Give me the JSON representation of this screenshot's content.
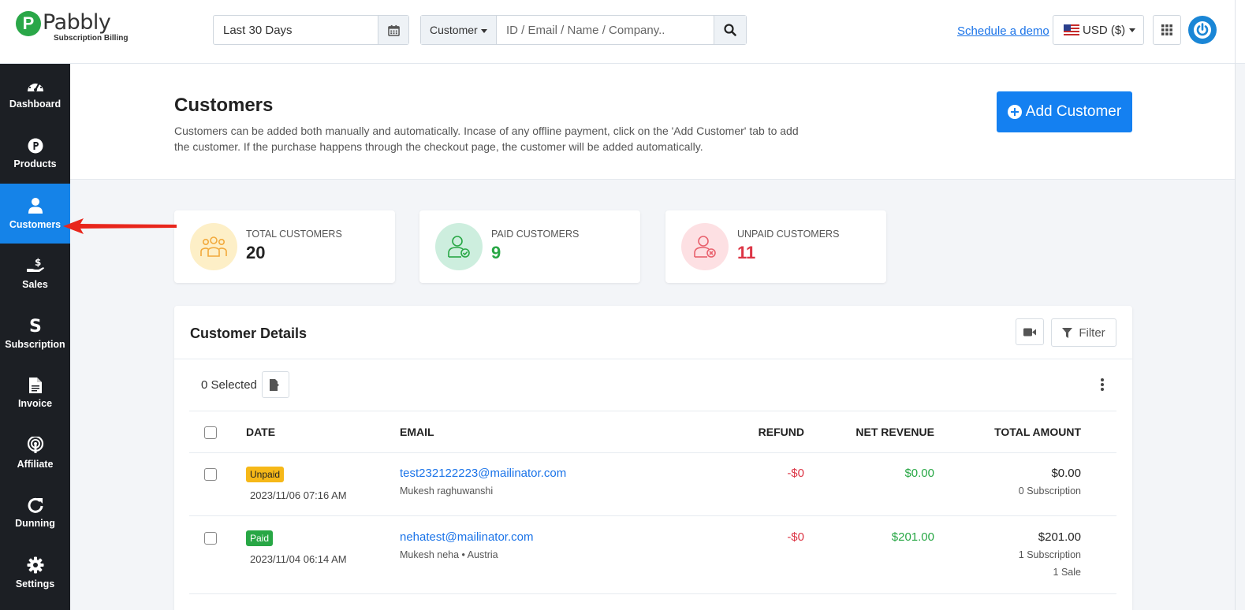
{
  "brand": {
    "logo_letter": "P",
    "name": "Pabbly",
    "subtitle": "Subscription Billing"
  },
  "topbar": {
    "date_range": "Last 30 Days",
    "search_type": "Customer",
    "search_placeholder": "ID / Email / Name / Company..",
    "schedule_link": "Schedule a demo",
    "currency": "USD ($)"
  },
  "sidebar": {
    "items": [
      {
        "label": "Dashboard",
        "icon": "speedometer-icon"
      },
      {
        "label": "Products",
        "icon": "products-p-icon"
      },
      {
        "label": "Customers",
        "icon": "user-icon",
        "active": true
      },
      {
        "label": "Sales",
        "icon": "hand-dollar-icon"
      },
      {
        "label": "Subscription",
        "icon": "subscription-s-icon"
      },
      {
        "label": "Invoice",
        "icon": "file-icon"
      },
      {
        "label": "Affiliate",
        "icon": "broadcast-icon"
      },
      {
        "label": "Dunning",
        "icon": "refresh-icon"
      },
      {
        "label": "Settings",
        "icon": "gear-icon"
      }
    ]
  },
  "header": {
    "title": "Customers",
    "description": "Customers can be added both manually and automatically. Incase of any offline payment, click on the 'Add Customer' tab to add the customer. If the purchase happens through the checkout page, the customer will be added automatically.",
    "add_button": "Add Customer"
  },
  "stats": {
    "total": {
      "label": "TOTAL CUSTOMERS",
      "value": "20",
      "color": "#222222",
      "bg": "#fdefc7",
      "icon_color": "#f2a93b"
    },
    "paid": {
      "label": "PAID CUSTOMERS",
      "value": "9",
      "color": "#28a745",
      "bg": "#cdeede",
      "icon_color": "#28a745"
    },
    "unpaid": {
      "label": "UNPAID CUSTOMERS",
      "value": "11",
      "color": "#dc3545",
      "bg": "#fde0e3",
      "icon_color": "#e8616d"
    }
  },
  "details": {
    "title": "Customer Details",
    "filter_label": "Filter",
    "selected_text": "0 Selected",
    "columns": {
      "date": "DATE",
      "email": "EMAIL",
      "refund": "REFUND",
      "net_revenue": "NET REVENUE",
      "total_amount": "TOTAL AMOUNT"
    },
    "rows": [
      {
        "status": "Unpaid",
        "date": "2023/11/06 07:16 AM",
        "email": "test232122223@mailinator.com",
        "name": "Mukesh raghuwanshi",
        "refund": "-$0",
        "net_revenue": "$0.00",
        "total": "$0.00",
        "sub1": "0 Subscription",
        "sub2": ""
      },
      {
        "status": "Paid",
        "date": "2023/11/04 06:14 AM",
        "email": "nehatest@mailinator.com",
        "name": "Mukesh neha • Austria",
        "refund": "-$0",
        "net_revenue": "$201.00",
        "total": "$201.00",
        "sub1": "1 Subscription",
        "sub2": "1 Sale"
      }
    ]
  },
  "colors": {
    "accent": "#1583e8",
    "sidebar_bg": "#1c1f24",
    "annotation_arrow": "#e8261c"
  }
}
